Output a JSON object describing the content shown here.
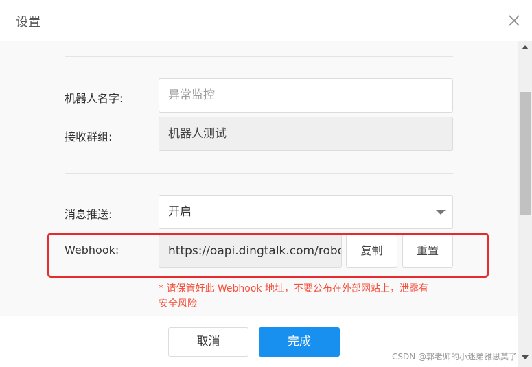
{
  "dialog": {
    "title": "设置"
  },
  "form": {
    "robot_name": {
      "label": "机器人名字:",
      "placeholder": "异常监控"
    },
    "receive_group": {
      "label": "接收群组:",
      "value": "机器人测试"
    },
    "push": {
      "label": "消息推送:",
      "value": "开启"
    },
    "webhook": {
      "label": "Webhook:",
      "value": "https://oapi.dingtalk.com/robot",
      "copy_label": "复制",
      "reset_label": "重置"
    },
    "warning_line1": "* 请保管好此 Webhook 地址，不要公布在外部网站上，泄露有",
    "warning_line2": "安全风险"
  },
  "footer": {
    "cancel_label": "取消",
    "done_label": "完成",
    "watermark": "CSDN @郭老师的小迷弟雅思莫了"
  },
  "colors": {
    "primary": "#1890ef",
    "warning": "#f5503c",
    "highlight": "#e52b2b"
  }
}
